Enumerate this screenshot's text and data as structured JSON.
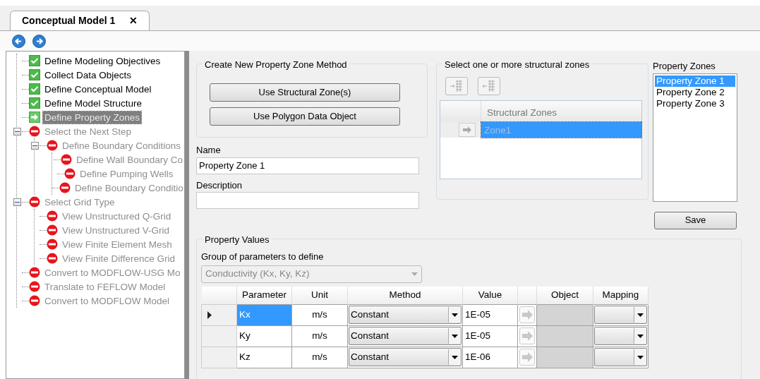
{
  "tab": {
    "title": "Conceptual Model 1",
    "close": "✕",
    "selected": true
  },
  "tree": [
    {
      "label": "Define Modeling Objectives",
      "kind": "done",
      "selected": false
    },
    {
      "label": "Collect Data Objects",
      "kind": "done",
      "selected": false
    },
    {
      "label": "Define  Conceptual Model",
      "kind": "done",
      "selected": false
    },
    {
      "label": "Define  Model Structure",
      "kind": "done",
      "selected": false
    },
    {
      "label": "Define  Property Zones",
      "kind": "current",
      "selected": true
    },
    {
      "label": "Select the Next Step",
      "kind": "blocked",
      "selected": false,
      "expanded": true,
      "children": [
        {
          "label": "Define Boundary Conditions",
          "kind": "blocked",
          "selected": false,
          "expanded": true,
          "children": [
            {
              "label": "Define Wall Boundary Co",
              "kind": "blocked",
              "selected": false
            },
            {
              "label": "Define Pumping Wells",
              "kind": "blocked",
              "selected": false
            },
            {
              "label": "Define Boundary Conditio",
              "kind": "blocked",
              "selected": false
            }
          ]
        }
      ]
    },
    {
      "label": "Select Grid Type",
      "kind": "blocked",
      "selected": false,
      "expanded": true,
      "children": [
        {
          "label": "View Unstructured Q-Grid",
          "kind": "blocked",
          "selected": false
        },
        {
          "label": "View Unstructured V-Grid",
          "kind": "blocked",
          "selected": false
        },
        {
          "label": "View Finite Element Mesh",
          "kind": "blocked",
          "selected": false
        },
        {
          "label": "View Finite Difference Grid",
          "kind": "blocked",
          "selected": false
        }
      ]
    },
    {
      "label": "Convert to MODFLOW-USG Mo",
      "kind": "blocked",
      "selected": false
    },
    {
      "label": "Translate to FEFLOW Model",
      "kind": "blocked",
      "selected": false
    },
    {
      "label": "Convert to MODFLOW Model",
      "kind": "blocked",
      "selected": false
    }
  ],
  "create_method": {
    "title": "Create New Property Zone Method",
    "buttons": [
      "Use Structural Zone(s)",
      "Use Polygon Data Object"
    ]
  },
  "name": {
    "label": "Name",
    "value": "Property Zone 1"
  },
  "description": {
    "label": "Description"
  },
  "structural_zones": {
    "title": "Select one or more structural zones",
    "column": "Structural Zones",
    "rows": [
      {
        "zone": "Zone1",
        "selected": true
      }
    ]
  },
  "property_zones": {
    "label": "Property Zones",
    "items": [
      {
        "label": "Property Zone 1",
        "selected": true
      },
      {
        "label": "Property Zone 2",
        "selected": false
      },
      {
        "label": "Property Zone 3",
        "selected": false
      }
    ]
  },
  "save_button": "Save",
  "property_values": {
    "title": "Property Values",
    "group_label": "Group of parameters to define",
    "group_select": {
      "value": "Conductivity (Kx, Ky, Kz)",
      "disabled": true
    },
    "columns": [
      "Parameter",
      "Unit",
      "Method",
      "Value",
      "Object",
      "Mapping"
    ],
    "rows": [
      {
        "parameter": "Kx",
        "unit": "m/s",
        "method": "Constant",
        "value": "1E-05",
        "selected": true
      },
      {
        "parameter": "Ky",
        "unit": "m/s",
        "method": "Constant",
        "value": "1E-05",
        "selected": false
      },
      {
        "parameter": "Kz",
        "unit": "m/s",
        "method": "Constant",
        "value": "1E-06",
        "selected": false
      }
    ]
  }
}
